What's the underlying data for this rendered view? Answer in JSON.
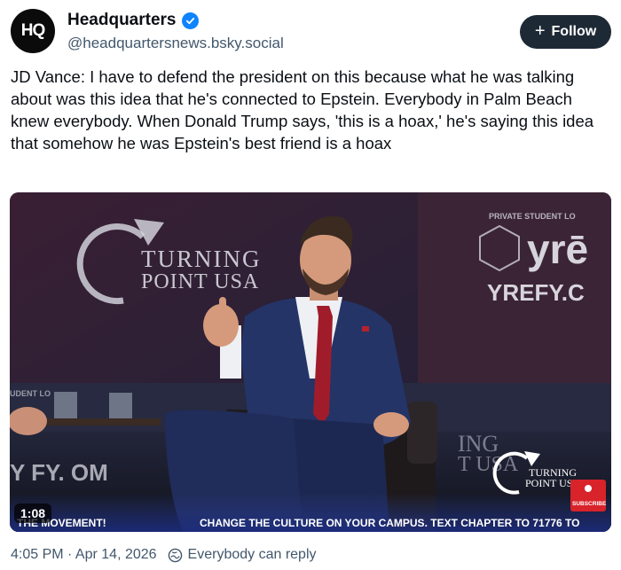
{
  "author": {
    "avatar_text": "HQ",
    "display_name": "Headquarters",
    "handle": "@headquartersnews.bsky.social",
    "verified_color": "#1083fe"
  },
  "follow_button": {
    "plus": "+",
    "label": "Follow"
  },
  "post_text": "JD Vance: I have to defend the president on this because what he was talking about was this idea that he's connected to Epstein. Everybody in Palm Beach knew everybody. When Donald Trump says, 'this is a hoax,' he's saying this idea that somehow he was Epstein's best friend is a hoax",
  "video": {
    "duration": "1:08",
    "backdrop_logo_line1": "TURNING",
    "backdrop_logo_line2": "POINT USA",
    "sponsor_small": "PRIVATE STUDENT LO",
    "sponsor_logo": "yrē",
    "sponsor_url": "YREFY.C",
    "left_banner_partial_1": "UDENT LO",
    "left_banner_partial_2": "Y  FY.  OM",
    "right_banner_partial": "ING\nT USA",
    "watermark_line1": "TURNING",
    "watermark_line2": "POINT USA",
    "subscribe_label": "SUBSCRIBE",
    "ticker_left": "THE MOVEMENT!",
    "ticker_right": "CHANGE THE CULTURE ON YOUR CAMPUS. TEXT CHAPTER TO 71776 TO"
  },
  "meta": {
    "timestamp": "4:05 PM · Apr 14, 2026",
    "reply_setting": "Everybody can reply"
  }
}
